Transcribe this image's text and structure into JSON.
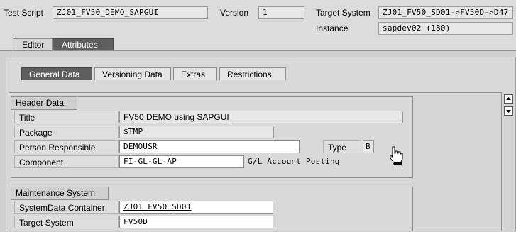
{
  "header": {
    "test_script_label": "Test Script",
    "test_script_value": "ZJ01_FV50_DEMO_SAPGUI",
    "version_label": "Version",
    "version_value": "1",
    "target_system_label": "Target System",
    "target_system_value": "ZJ01_FV50_SD01->FV50D->D47",
    "instance_label": "Instance",
    "instance_value": "sapdev02  (180)"
  },
  "main_tabs": [
    {
      "label": "Editor"
    },
    {
      "label": "Attributes"
    }
  ],
  "sub_tabs": [
    {
      "label": "General Data"
    },
    {
      "label": "Versioning Data"
    },
    {
      "label": "Extras"
    },
    {
      "label": "Restrictions"
    }
  ],
  "header_data": {
    "title": "Header Data",
    "title_label": "Title",
    "title_value": "FV50 DEMO using SAPGUI",
    "package_label": "Package",
    "package_value": "$TMP",
    "person_label": "Person Responsible",
    "person_value": "DEMOUSR",
    "type_label": "Type",
    "type_value": "B",
    "component_label": "Component",
    "component_value": "FI-GL-GL-AP",
    "component_desc": "G/L Account Posting"
  },
  "maintenance_system": {
    "title": "Maintenance System",
    "container_label": "SystemData Container",
    "container_value": "ZJ01_FV50_SD01",
    "target_label": "Target System",
    "target_value": "FV50D"
  },
  "scrollbar": {
    "up_icon": "arrow-up-icon",
    "down_icon": "arrow-down-icon"
  }
}
